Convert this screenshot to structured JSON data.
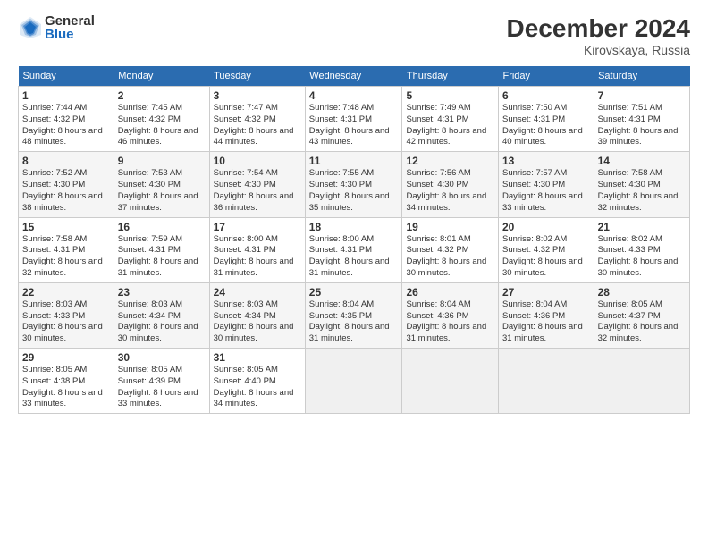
{
  "header": {
    "logo_general": "General",
    "logo_blue": "Blue",
    "month_title": "December 2024",
    "location": "Kirovskaya, Russia"
  },
  "weekdays": [
    "Sunday",
    "Monday",
    "Tuesday",
    "Wednesday",
    "Thursday",
    "Friday",
    "Saturday"
  ],
  "weeks": [
    [
      {
        "day": "1",
        "sunrise": "7:44 AM",
        "sunset": "4:32 PM",
        "daylight": "8 hours and 48 minutes."
      },
      {
        "day": "2",
        "sunrise": "7:45 AM",
        "sunset": "4:32 PM",
        "daylight": "8 hours and 46 minutes."
      },
      {
        "day": "3",
        "sunrise": "7:47 AM",
        "sunset": "4:32 PM",
        "daylight": "8 hours and 44 minutes."
      },
      {
        "day": "4",
        "sunrise": "7:48 AM",
        "sunset": "4:31 PM",
        "daylight": "8 hours and 43 minutes."
      },
      {
        "day": "5",
        "sunrise": "7:49 AM",
        "sunset": "4:31 PM",
        "daylight": "8 hours and 42 minutes."
      },
      {
        "day": "6",
        "sunrise": "7:50 AM",
        "sunset": "4:31 PM",
        "daylight": "8 hours and 40 minutes."
      },
      {
        "day": "7",
        "sunrise": "7:51 AM",
        "sunset": "4:31 PM",
        "daylight": "8 hours and 39 minutes."
      }
    ],
    [
      {
        "day": "8",
        "sunrise": "7:52 AM",
        "sunset": "4:30 PM",
        "daylight": "8 hours and 38 minutes."
      },
      {
        "day": "9",
        "sunrise": "7:53 AM",
        "sunset": "4:30 PM",
        "daylight": "8 hours and 37 minutes."
      },
      {
        "day": "10",
        "sunrise": "7:54 AM",
        "sunset": "4:30 PM",
        "daylight": "8 hours and 36 minutes."
      },
      {
        "day": "11",
        "sunrise": "7:55 AM",
        "sunset": "4:30 PM",
        "daylight": "8 hours and 35 minutes."
      },
      {
        "day": "12",
        "sunrise": "7:56 AM",
        "sunset": "4:30 PM",
        "daylight": "8 hours and 34 minutes."
      },
      {
        "day": "13",
        "sunrise": "7:57 AM",
        "sunset": "4:30 PM",
        "daylight": "8 hours and 33 minutes."
      },
      {
        "day": "14",
        "sunrise": "7:58 AM",
        "sunset": "4:30 PM",
        "daylight": "8 hours and 32 minutes."
      }
    ],
    [
      {
        "day": "15",
        "sunrise": "7:58 AM",
        "sunset": "4:31 PM",
        "daylight": "8 hours and 32 minutes."
      },
      {
        "day": "16",
        "sunrise": "7:59 AM",
        "sunset": "4:31 PM",
        "daylight": "8 hours and 31 minutes."
      },
      {
        "day": "17",
        "sunrise": "8:00 AM",
        "sunset": "4:31 PM",
        "daylight": "8 hours and 31 minutes."
      },
      {
        "day": "18",
        "sunrise": "8:00 AM",
        "sunset": "4:31 PM",
        "daylight": "8 hours and 31 minutes."
      },
      {
        "day": "19",
        "sunrise": "8:01 AM",
        "sunset": "4:32 PM",
        "daylight": "8 hours and 30 minutes."
      },
      {
        "day": "20",
        "sunrise": "8:02 AM",
        "sunset": "4:32 PM",
        "daylight": "8 hours and 30 minutes."
      },
      {
        "day": "21",
        "sunrise": "8:02 AM",
        "sunset": "4:33 PM",
        "daylight": "8 hours and 30 minutes."
      }
    ],
    [
      {
        "day": "22",
        "sunrise": "8:03 AM",
        "sunset": "4:33 PM",
        "daylight": "8 hours and 30 minutes."
      },
      {
        "day": "23",
        "sunrise": "8:03 AM",
        "sunset": "4:34 PM",
        "daylight": "8 hours and 30 minutes."
      },
      {
        "day": "24",
        "sunrise": "8:03 AM",
        "sunset": "4:34 PM",
        "daylight": "8 hours and 30 minutes."
      },
      {
        "day": "25",
        "sunrise": "8:04 AM",
        "sunset": "4:35 PM",
        "daylight": "8 hours and 31 minutes."
      },
      {
        "day": "26",
        "sunrise": "8:04 AM",
        "sunset": "4:36 PM",
        "daylight": "8 hours and 31 minutes."
      },
      {
        "day": "27",
        "sunrise": "8:04 AM",
        "sunset": "4:36 PM",
        "daylight": "8 hours and 31 minutes."
      },
      {
        "day": "28",
        "sunrise": "8:05 AM",
        "sunset": "4:37 PM",
        "daylight": "8 hours and 32 minutes."
      }
    ],
    [
      {
        "day": "29",
        "sunrise": "8:05 AM",
        "sunset": "4:38 PM",
        "daylight": "8 hours and 33 minutes."
      },
      {
        "day": "30",
        "sunrise": "8:05 AM",
        "sunset": "4:39 PM",
        "daylight": "8 hours and 33 minutes."
      },
      {
        "day": "31",
        "sunrise": "8:05 AM",
        "sunset": "4:40 PM",
        "daylight": "8 hours and 34 minutes."
      },
      null,
      null,
      null,
      null
    ]
  ]
}
